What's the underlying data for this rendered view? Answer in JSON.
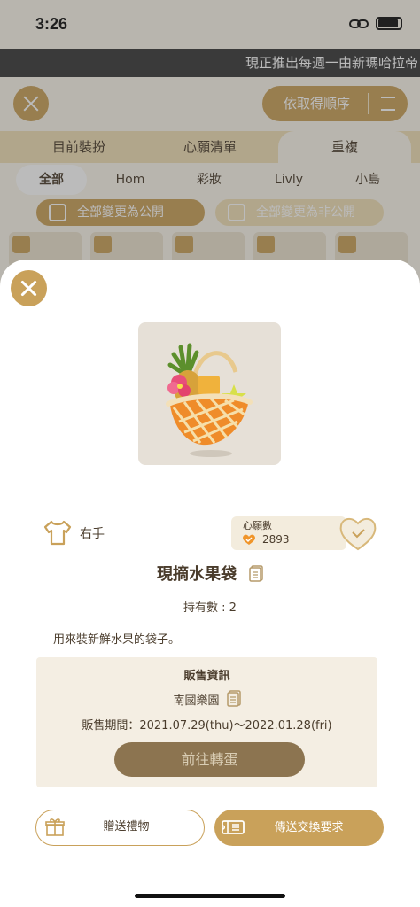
{
  "status_bar": {
    "time": "3:26"
  },
  "marquee": {
    "text": "現正推出每週一由新瑪哈拉帝"
  },
  "background": {
    "sort_label": "依取得順序",
    "tabs": [
      "目前裝扮",
      "心願清單",
      "重複"
    ],
    "subtabs": [
      "全部",
      "Hom",
      "彩妝",
      "Livly",
      "小島"
    ],
    "public_all": "全部變更為公開",
    "private_all": "全部變更為非公開"
  },
  "item": {
    "slot_label": "右手",
    "wish_title": "心願數",
    "wish_count": "2893",
    "name": "現摘水果袋",
    "owned": "持有數 : 2",
    "description": "用來裝新鮮水果的袋子。"
  },
  "sale": {
    "title": "販售資訊",
    "location": "南國樂園",
    "period": "販售期間：2021.07.29(thu)～2022.01.28(fri)",
    "go_button": "前往轉蛋"
  },
  "actions": {
    "gift": "贈送禮物",
    "trade": "傳送交換要求"
  },
  "colors": {
    "accent": "#c9a15a",
    "button_dark": "#8c7450",
    "info_bg": "#f4eee3"
  }
}
